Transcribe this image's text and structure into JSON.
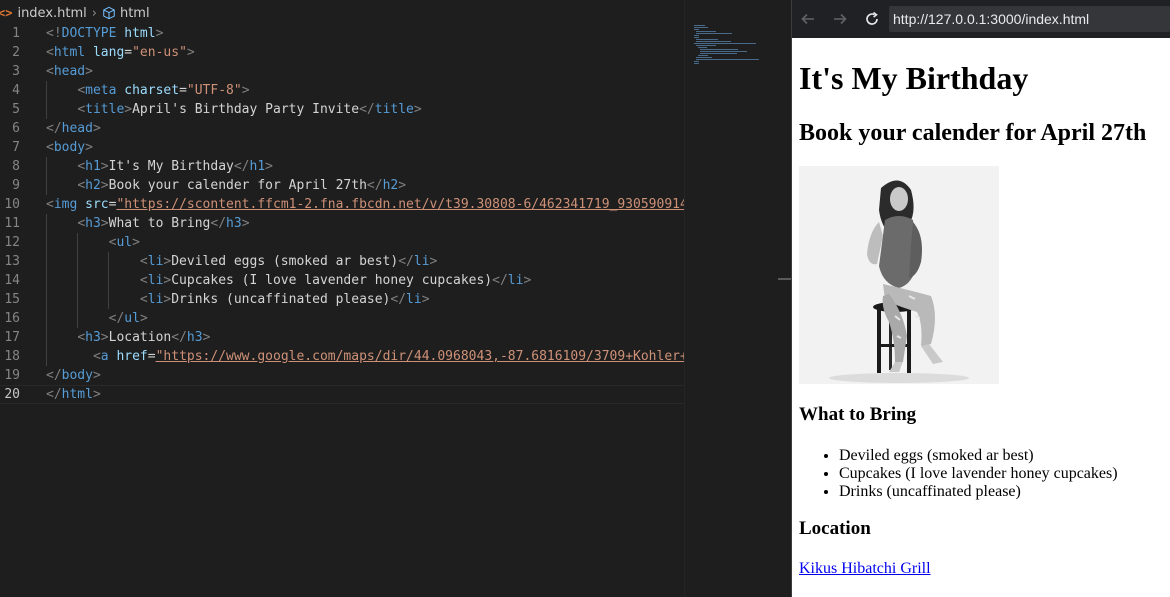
{
  "editor": {
    "breadcrumb": {
      "file": "index.html",
      "symbol": "html"
    },
    "current_line": 20,
    "lines": [
      {
        "n": "1",
        "indent": 0,
        "tokens": [
          [
            "t",
            "<!"
          ],
          [
            "tn",
            "DOCTYPE"
          ],
          [
            "tx",
            " "
          ],
          [
            "an",
            "html"
          ],
          [
            "t",
            ">"
          ]
        ]
      },
      {
        "n": "2",
        "indent": 0,
        "tokens": [
          [
            "t",
            "<"
          ],
          [
            "tn",
            "html"
          ],
          [
            "tx",
            " "
          ],
          [
            "an",
            "lang"
          ],
          [
            "tx",
            "="
          ],
          [
            "av",
            "\"en-us\""
          ],
          [
            "t",
            ">"
          ]
        ]
      },
      {
        "n": "3",
        "indent": 0,
        "tokens": [
          [
            "t",
            "<"
          ],
          [
            "tn",
            "head"
          ],
          [
            "t",
            ">"
          ]
        ]
      },
      {
        "n": "4",
        "indent": 1,
        "tokens": [
          [
            "t",
            "<"
          ],
          [
            "tn",
            "meta"
          ],
          [
            "tx",
            " "
          ],
          [
            "an",
            "charset"
          ],
          [
            "tx",
            "="
          ],
          [
            "av",
            "\"UTF-8\""
          ],
          [
            "t",
            ">"
          ]
        ]
      },
      {
        "n": "5",
        "indent": 1,
        "tokens": [
          [
            "t",
            "<"
          ],
          [
            "tn",
            "title"
          ],
          [
            "t",
            ">"
          ],
          [
            "tx",
            "April's Birthday Party Invite"
          ],
          [
            "t",
            "</"
          ],
          [
            "tn",
            "title"
          ],
          [
            "t",
            ">"
          ]
        ]
      },
      {
        "n": "6",
        "indent": 0,
        "tokens": [
          [
            "t",
            "</"
          ],
          [
            "tn",
            "head"
          ],
          [
            "t",
            ">"
          ]
        ]
      },
      {
        "n": "7",
        "indent": 0,
        "tokens": [
          [
            "t",
            "<"
          ],
          [
            "tn",
            "body"
          ],
          [
            "t",
            ">"
          ]
        ]
      },
      {
        "n": "8",
        "indent": 1,
        "tokens": [
          [
            "t",
            "<"
          ],
          [
            "tn",
            "h1"
          ],
          [
            "t",
            ">"
          ],
          [
            "tx",
            "It's My Birthday"
          ],
          [
            "t",
            "</"
          ],
          [
            "tn",
            "h1"
          ],
          [
            "t",
            ">"
          ]
        ]
      },
      {
        "n": "9",
        "indent": 1,
        "tokens": [
          [
            "t",
            "<"
          ],
          [
            "tn",
            "h2"
          ],
          [
            "t",
            ">"
          ],
          [
            "tx",
            "Book your calender for April 27th"
          ],
          [
            "t",
            "</"
          ],
          [
            "tn",
            "h2"
          ],
          [
            "t",
            ">"
          ]
        ]
      },
      {
        "n": "10",
        "indent": 0,
        "tokens": [
          [
            "t",
            "<"
          ],
          [
            "tn",
            "img"
          ],
          [
            "tx",
            " "
          ],
          [
            "an",
            "src"
          ],
          [
            "tx",
            "="
          ],
          [
            "av url",
            "\"https://scontent.ffcm1-2.fna.fbcdn.net/v/t39.30808-6/462341719_9305909149"
          ]
        ]
      },
      {
        "n": "11",
        "indent": 1,
        "tokens": [
          [
            "t",
            "<"
          ],
          [
            "tn",
            "h3"
          ],
          [
            "t",
            ">"
          ],
          [
            "tx",
            "What to Bring"
          ],
          [
            "t",
            "</"
          ],
          [
            "tn",
            "h3"
          ],
          [
            "t",
            ">"
          ]
        ]
      },
      {
        "n": "12",
        "indent": 2,
        "tokens": [
          [
            "t",
            "<"
          ],
          [
            "tn",
            "ul"
          ],
          [
            "t",
            ">"
          ]
        ]
      },
      {
        "n": "13",
        "indent": 3,
        "tokens": [
          [
            "t",
            "<"
          ],
          [
            "tn",
            "li"
          ],
          [
            "t",
            ">"
          ],
          [
            "tx",
            "Deviled eggs (smoked ar best)"
          ],
          [
            "t",
            "</"
          ],
          [
            "tn",
            "li"
          ],
          [
            "t",
            ">"
          ]
        ]
      },
      {
        "n": "14",
        "indent": 3,
        "tokens": [
          [
            "t",
            "<"
          ],
          [
            "tn",
            "li"
          ],
          [
            "t",
            ">"
          ],
          [
            "tx",
            "Cupcakes (I love lavender honey cupcakes)"
          ],
          [
            "t",
            "</"
          ],
          [
            "tn",
            "li"
          ],
          [
            "t",
            ">"
          ]
        ]
      },
      {
        "n": "15",
        "indent": 3,
        "tokens": [
          [
            "t",
            "<"
          ],
          [
            "tn",
            "li"
          ],
          [
            "t",
            ">"
          ],
          [
            "tx",
            "Drinks (uncaffinated please)"
          ],
          [
            "t",
            "</"
          ],
          [
            "tn",
            "li"
          ],
          [
            "t",
            ">"
          ]
        ]
      },
      {
        "n": "16",
        "indent": 2,
        "tokens": [
          [
            "t",
            "</"
          ],
          [
            "tn",
            "ul"
          ],
          [
            "t",
            ">"
          ]
        ]
      },
      {
        "n": "17",
        "indent": 1,
        "tokens": [
          [
            "t",
            "<"
          ],
          [
            "tn",
            "h3"
          ],
          [
            "t",
            ">"
          ],
          [
            "tx",
            "Location"
          ],
          [
            "t",
            "</"
          ],
          [
            "tn",
            "h3"
          ],
          [
            "t",
            ">"
          ]
        ]
      },
      {
        "n": "18",
        "indent": 1,
        "shift": "  ",
        "tokens": [
          [
            "t",
            "<"
          ],
          [
            "tn",
            "a"
          ],
          [
            "tx",
            " "
          ],
          [
            "an",
            "href"
          ],
          [
            "tx",
            "="
          ],
          [
            "av url",
            "\"https://www.google.com/maps/dir/44.0968043,-87.6816109/3709+Kohler+Memo"
          ]
        ]
      },
      {
        "n": "19",
        "indent": 0,
        "tokens": [
          [
            "t",
            "</"
          ],
          [
            "tn",
            "body"
          ],
          [
            "t",
            ">"
          ]
        ]
      },
      {
        "n": "20",
        "indent": 0,
        "tokens": [
          [
            "t",
            "</"
          ],
          [
            "tn",
            "html"
          ],
          [
            "t",
            ">"
          ]
        ]
      }
    ]
  },
  "browser": {
    "back_icon": "arrow-left-icon",
    "forward_icon": "arrow-right-icon",
    "reload_icon": "reload-icon",
    "url": "http://127.0.0.1:3000/index.html",
    "page": {
      "h1": "It's My Birthday",
      "h2": "Book your calender for April 27th",
      "photo_alt": "photo-of-woman-on-stool",
      "h3_bring": "What to Bring",
      "items": [
        "Deviled eggs (smoked ar best)",
        "Cupcakes (I love lavender honey cupcakes)",
        "Drinks (uncaffinated please)"
      ],
      "h3_location": "Location",
      "link": "Kikus Hibatchi Grill"
    }
  },
  "colors": {
    "editor_bg": "#1e1e1e",
    "tag": "#569cd6",
    "attr_name": "#9cdcfe",
    "attr_value": "#ce9178",
    "punctuation": "#808080",
    "text": "#d4d4d4",
    "link": "#0000ee"
  }
}
